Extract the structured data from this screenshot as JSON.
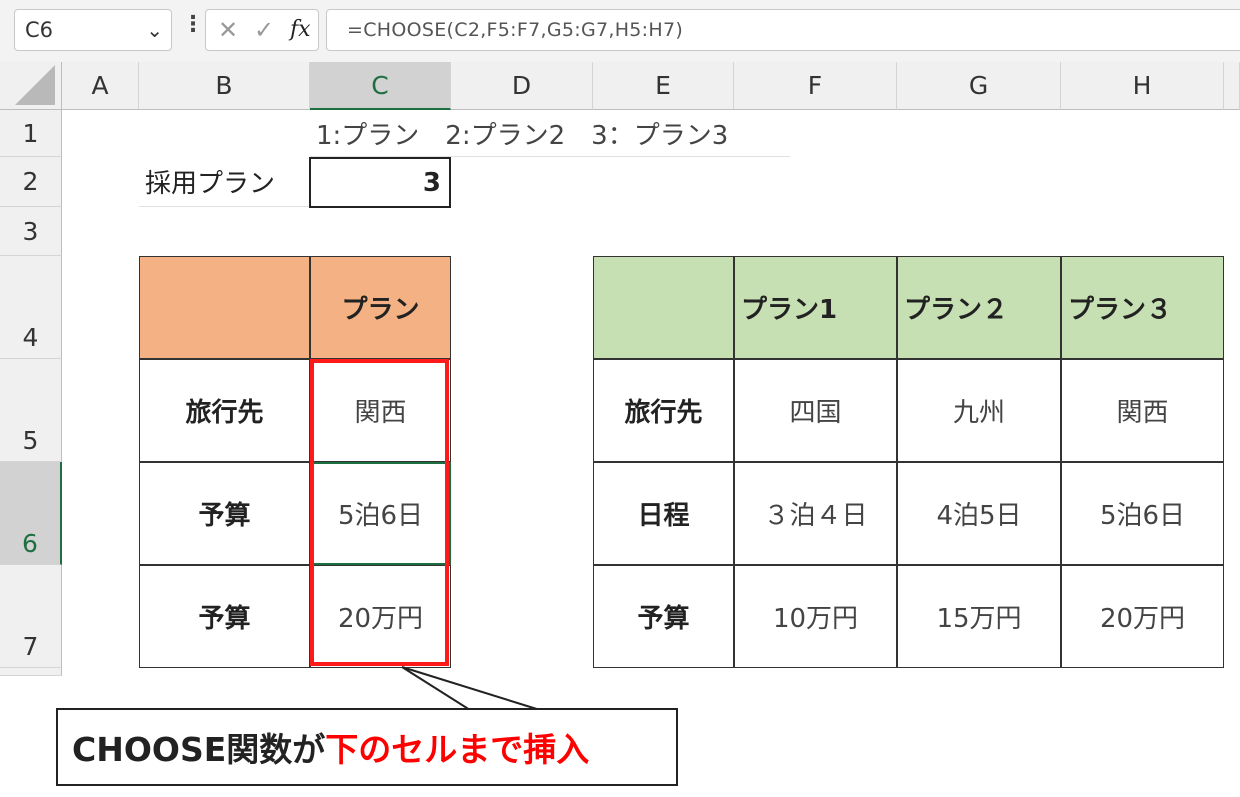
{
  "formula_bar": {
    "name_box": "C6",
    "name_box_arrow": "⌄",
    "more_icon": "⋮",
    "cancel_icon": "✕",
    "enter_icon": "✓",
    "fx_icon": "fx",
    "formula": "=CHOOSE(C2,F5:F7,G5:G7,H5:H7)"
  },
  "columns": [
    "A",
    "B",
    "C",
    "D",
    "E",
    "F",
    "G",
    "H"
  ],
  "rows": [
    "1",
    "2",
    "3",
    "4",
    "5",
    "6",
    "7"
  ],
  "sheet": {
    "note": "1:プラン　2:プラン2　3：プラン3",
    "adopted_label": "採用プラン",
    "adopted_value": "3",
    "left_table": {
      "header": "プラン",
      "row_labels": [
        "旅行先",
        "予算",
        "予算"
      ],
      "values": [
        "関西",
        "5泊6日",
        "20万円"
      ]
    },
    "right_table": {
      "headers": [
        "プラン1",
        "プラン２",
        "プラン３"
      ],
      "row_labels": [
        "旅行先",
        "日程",
        "予算"
      ],
      "rows": [
        [
          "四国",
          "九州",
          "関西"
        ],
        [
          "３泊４日",
          "4泊5日",
          "5泊6日"
        ],
        [
          "10万円",
          "15万円",
          "20万円"
        ]
      ]
    }
  },
  "callout": {
    "text_black": "CHOOSE関数が",
    "text_red": "下のセルまで挿入"
  },
  "colors": {
    "orange_header": "#f4b183",
    "green_header": "#c6e0b4",
    "highlight_red": "#ff1a1a",
    "selection_green": "#1d6f42"
  }
}
